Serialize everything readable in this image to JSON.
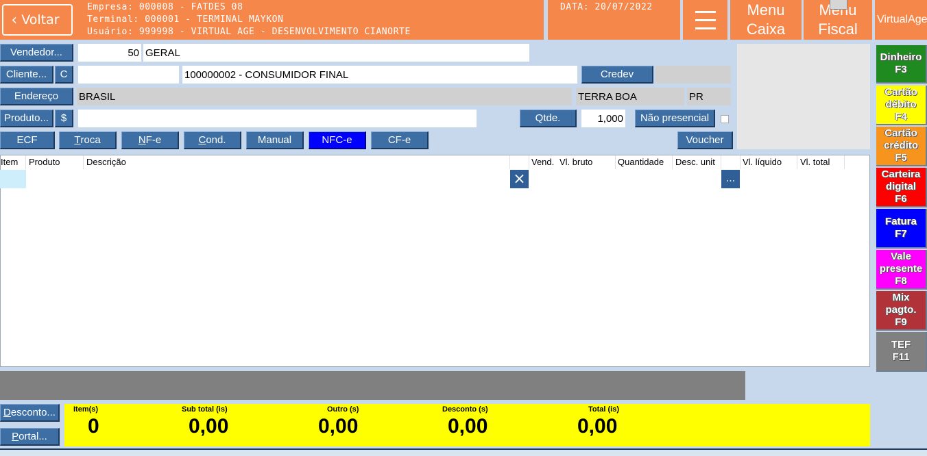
{
  "header": {
    "back_label": "Voltar",
    "empresa": "Empresa: 000008 - FATDES 08",
    "terminal": "Terminal: 000001 - TERMINAL MAYKON",
    "usuario": "Usuário: 999998 - VIRTUAL AGE - DESENVOLVIMENTO CIANORTE",
    "data": "DATA: 20/07/2022",
    "menu_caixa_1": "Menu",
    "menu_caixa_2": "Caixa",
    "menu_fiscal_1": "Menu",
    "menu_fiscal_2": "Fiscal",
    "user_label": "VirtualAge"
  },
  "form": {
    "vendedor_btn": "Vendedor...",
    "vendedor_code": "50",
    "vendedor_name": "GERAL",
    "cliente_btn": "Cliente...",
    "cliente_c_btn": "C",
    "cliente_code": "",
    "cliente_name": "100000002 - CONSUMIDOR FINAL",
    "credev_btn": "Credev",
    "credev_value": "",
    "endereco_btn": "Endereço",
    "pais": "BRASIL",
    "cidade": "TERRA BOA",
    "uf": "PR",
    "produto_btn": "Produto...",
    "produto_dollar_btn": "$",
    "produto_value": "",
    "qtde_btn": "Qtde.",
    "qtde_value": "1,000",
    "nao_presencial_btn": "Não presencial",
    "voucher_btn": "Voucher"
  },
  "doc_buttons": {
    "ecf": "ECF",
    "troca_u": "T",
    "troca_rest": "roca",
    "nfe_u": "N",
    "nfe_rest": "F-e",
    "cond_u": "C",
    "cond_rest": "ond.",
    "manual": "Manual",
    "nfce": "NFC-e",
    "cfe": "CF-e"
  },
  "grid": {
    "columns": [
      "Item",
      "Produto",
      "Descrição",
      "Vend.",
      "Vl. bruto",
      "Quantidade",
      "Desc. unit",
      "Vl. líquido",
      "Vl. total"
    ],
    "delete_icon": "×",
    "more_label": "..."
  },
  "bottom": {
    "desconto_u": "D",
    "desconto_rest": "esconto...",
    "portal_u": "P",
    "portal_rest": "ortal..."
  },
  "totals": {
    "itens_label": "Item(s)",
    "itens_value": "0",
    "subtotal_label": "Sub total (is)",
    "subtotal_value": "0,00",
    "outro_label": "Outro (s)",
    "outro_value": "0,00",
    "desconto_label": "Desconto (s)",
    "desconto_value": "0,00",
    "total_label": "Total (is)",
    "total_value": "0,00"
  },
  "payments": [
    {
      "line1": "Dinheiro",
      "line2": "F3",
      "color": "#1f8a1f"
    },
    {
      "line1": "Cartão",
      "line2": "débito",
      "line3": "F4",
      "color": "#ffff00"
    },
    {
      "line1": "Cartão",
      "line2": "crédito",
      "line3": "F5",
      "color": "#f7941d"
    },
    {
      "line1": "Carteira",
      "line2": "digital",
      "line3": "F6",
      "color": "#ff0000"
    },
    {
      "line1": "Fatura",
      "line2": "F7",
      "color": "#0000ff"
    },
    {
      "line1": "Vale",
      "line2": "presente",
      "line3": "F8",
      "color": "#ff00ff"
    },
    {
      "line1": "Mix",
      "line2": "pagto.",
      "line3": "F9",
      "color": "#b2323a"
    },
    {
      "line1": "TEF",
      "line2": "F11",
      "color": "#808080"
    }
  ]
}
